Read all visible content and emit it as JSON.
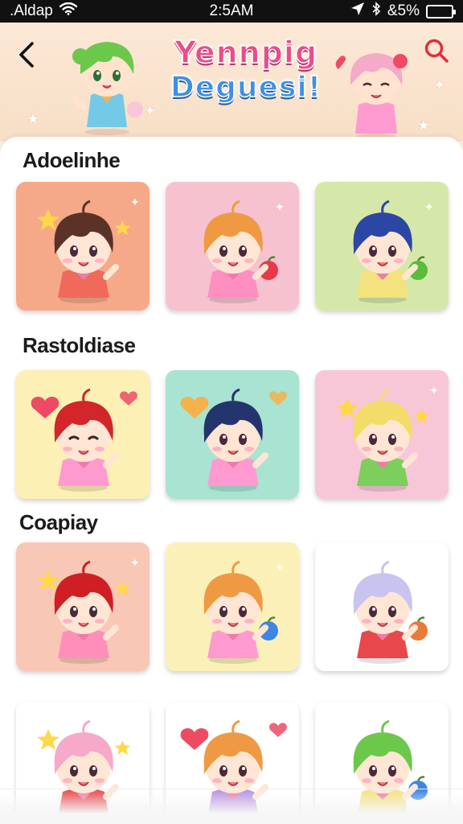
{
  "status_bar": {
    "carrier": ".Aldap",
    "time": "2:5AM",
    "battery_text": "&5%",
    "battery_level": 0.85,
    "icons": [
      "wifi-icon",
      "location-arrow-icon",
      "bluetooth-icon",
      "battery-icon"
    ]
  },
  "header": {
    "title_line1": "Yennpig",
    "title_line2": "Deguesi!",
    "back_icon": "chevron-left-icon",
    "search_icon": "search-icon",
    "title_colors": [
      "#ea4c89",
      "#3f8fe6"
    ]
  },
  "sections": [
    {
      "title": "Adoelinhe",
      "stickers": [
        {
          "bg": "#f6a988",
          "hair": "#5a3228",
          "outfit": "#ef6a5a",
          "prop": "stars",
          "prop_color": "#ffd84a",
          "mood": "happy"
        },
        {
          "bg": "#f6c2cf",
          "hair": "#ef9a43",
          "outfit": "#ff8fc0",
          "prop": "apple",
          "prop_color": "#e8384a",
          "mood": "happy"
        },
        {
          "bg": "#d6e8a9",
          "hair": "#2c46a6",
          "outfit": "#f3e27e",
          "prop": "apple",
          "prop_color": "#5bbb3c",
          "mood": "happy"
        }
      ]
    },
    {
      "title": "Rastoldiase",
      "stickers": [
        {
          "bg": "#fdf0b4",
          "hair": "#d2262a",
          "outfit": "#ff9ad0",
          "prop": "heart",
          "prop_color": "#ef4a64",
          "mood": "wink"
        },
        {
          "bg": "#a9e3d2",
          "hair": "#24356e",
          "outfit": "#ff9ad0",
          "prop": "heart",
          "prop_color": "#f5b24a",
          "mood": "happy"
        },
        {
          "bg": "#f7c7d8",
          "hair": "#f4dc6a",
          "outfit": "#7ccf5c",
          "prop": "stars",
          "prop_color": "#ffd84a",
          "mood": "happy"
        }
      ]
    },
    {
      "title": "Coapiay",
      "stickers": [
        {
          "bg": "#f8c7b6",
          "hair": "#cf1f24",
          "outfit": "#ff8fb8",
          "prop": "stars",
          "prop_color": "#ffd84a",
          "mood": "happy"
        },
        {
          "bg": "#fbf1b8",
          "hair": "#ef9a43",
          "outfit": "#ff9ad0",
          "prop": "apple",
          "prop_color": "#3b86e6",
          "mood": "happy"
        },
        {
          "bg": "#ffffff",
          "hair": "#c9c3f0",
          "outfit": "#e8484a",
          "prop": "apple",
          "prop_color": "#e87a3a",
          "mood": "happy"
        }
      ]
    },
    {
      "title": "",
      "stickers": [
        {
          "bg": "#ffffff",
          "hair": "#f6a9c9",
          "outfit": "#e8484a",
          "prop": "stars",
          "prop_color": "#ffd84a",
          "mood": "happy"
        },
        {
          "bg": "#ffffff",
          "hair": "#ef9a43",
          "outfit": "#b891e0",
          "prop": "heart",
          "prop_color": "#ef4a64",
          "mood": "happy"
        },
        {
          "bg": "#ffffff",
          "hair": "#6cc84a",
          "outfit": "#f3e27e",
          "prop": "apple",
          "prop_color": "#3b86e6",
          "mood": "happy"
        }
      ]
    }
  ]
}
